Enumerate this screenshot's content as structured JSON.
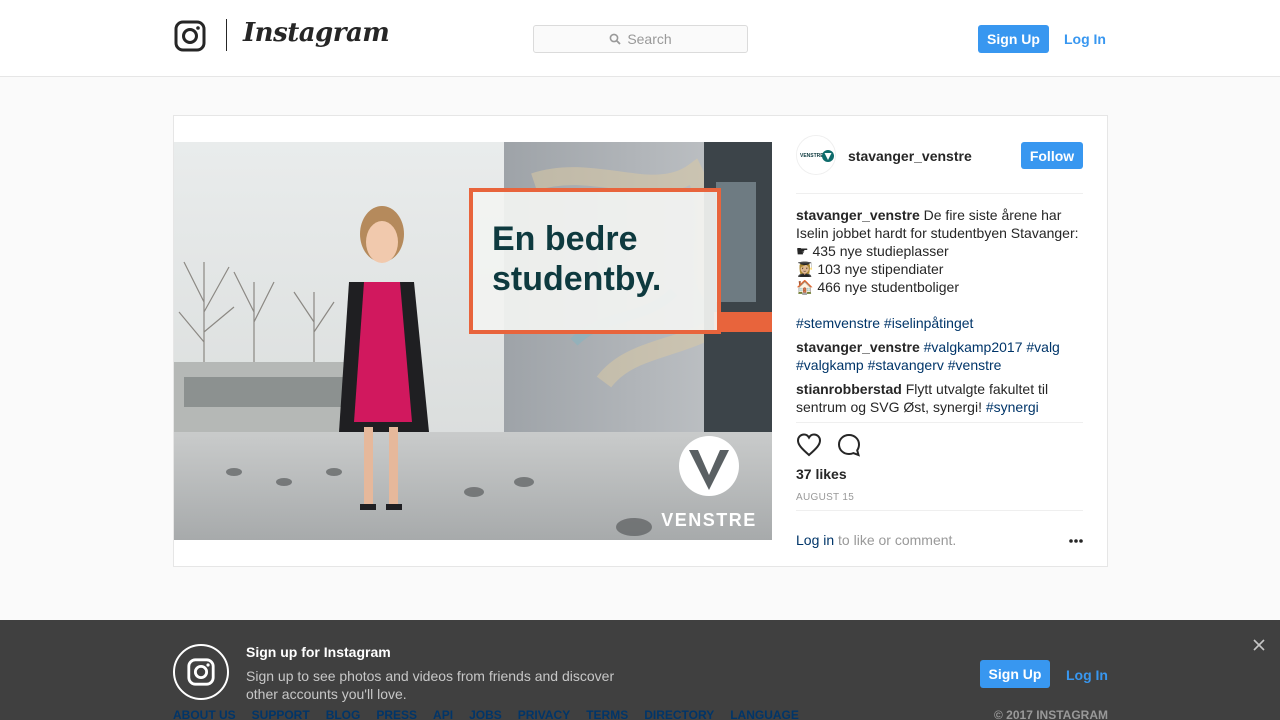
{
  "header": {
    "brand": "Instagram",
    "search_placeholder": "Search",
    "signup_label": "Sign Up",
    "login_label": "Log In"
  },
  "post": {
    "image": {
      "headline_line1": "En bedre",
      "headline_line2": "studentby.",
      "party_logo_text": "VENSTRE",
      "accent_color": "#e8643c",
      "headline_color": "#0e3a3f"
    },
    "author": {
      "username": "stavanger_venstre",
      "avatar_text": "VENSTRE",
      "follow_label": "Follow"
    },
    "caption": {
      "username": "stavanger_venstre",
      "text_line1": "De fire siste årene har Iselin jobbet hardt for studentbyen Stavanger:",
      "bullet1": "☛ 435 nye studieplasser",
      "bullet2": "👩🏼‍🎓 103 nye stipendiater",
      "bullet3": "🏠 466 nye studentboliger",
      "hashtags": "#stemvenstre #iselinpåtinget"
    },
    "comments": [
      {
        "username": "stavanger_venstre",
        "text": "",
        "tags": "#valgkamp2017 #valg #valgkamp #stavangerv #venstre"
      },
      {
        "username": "stianrobberstad",
        "text": "Flytt utvalgte fakultet til sentrum og SVG Øst, synergi! ",
        "tags": "#synergi"
      }
    ],
    "likes_text": "37 likes",
    "date_text": "AUGUST 15",
    "login_prompt_link": "Log in",
    "login_prompt_rest": " to like or comment."
  },
  "banner": {
    "title": "Sign up for Instagram",
    "text": "Sign up to see photos and videos from friends and discover other accounts you'll love.",
    "signup_label": "Sign Up",
    "login_label": "Log In"
  },
  "footer": {
    "links": [
      "ABOUT US",
      "SUPPORT",
      "BLOG",
      "PRESS",
      "API",
      "JOBS",
      "PRIVACY",
      "TERMS",
      "DIRECTORY",
      "LANGUAGE"
    ],
    "copyright": "© 2017 INSTAGRAM"
  },
  "colors": {
    "brand_blue": "#3897f0",
    "link_dark_blue": "#003569"
  }
}
